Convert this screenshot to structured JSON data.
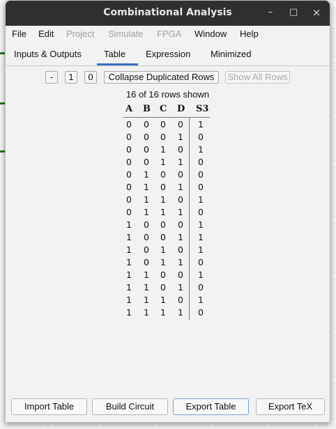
{
  "window": {
    "title": "Combinational Analysis",
    "controls": [
      "–",
      "□",
      "×"
    ]
  },
  "menu": [
    "File",
    "Edit",
    "Project",
    "Simulate",
    "FPGA",
    "Window",
    "Help"
  ],
  "menu_disabled": [
    false,
    false,
    true,
    true,
    true,
    false,
    false
  ],
  "tabs": [
    "Inputs & Outputs",
    "Table",
    "Expression",
    "Minimized"
  ],
  "active_tab": "Table",
  "toolbar": {
    "minus": "-",
    "one": "1",
    "zero": "0",
    "collapse": "Collapse Duplicated Rows",
    "show_all": "Show All Rows"
  },
  "rows_shown": "16 of 16 rows shown",
  "table": {
    "headers": [
      "A",
      "B",
      "C",
      "D",
      "S3"
    ],
    "rows": [
      [
        "0",
        "0",
        "0",
        "0",
        "1"
      ],
      [
        "0",
        "0",
        "0",
        "1",
        "0"
      ],
      [
        "0",
        "0",
        "1",
        "0",
        "1"
      ],
      [
        "0",
        "0",
        "1",
        "1",
        "0"
      ],
      [
        "0",
        "1",
        "0",
        "0",
        "0"
      ],
      [
        "0",
        "1",
        "0",
        "1",
        "0"
      ],
      [
        "0",
        "1",
        "1",
        "0",
        "1"
      ],
      [
        "0",
        "1",
        "1",
        "1",
        "0"
      ],
      [
        "1",
        "0",
        "0",
        "0",
        "1"
      ],
      [
        "1",
        "0",
        "0",
        "1",
        "1"
      ],
      [
        "1",
        "0",
        "1",
        "0",
        "1"
      ],
      [
        "1",
        "0",
        "1",
        "1",
        "0"
      ],
      [
        "1",
        "1",
        "0",
        "0",
        "1"
      ],
      [
        "1",
        "1",
        "0",
        "1",
        "0"
      ],
      [
        "1",
        "1",
        "1",
        "0",
        "1"
      ],
      [
        "1",
        "1",
        "1",
        "1",
        "0"
      ]
    ]
  },
  "footer": [
    "Import Table",
    "Build Circuit",
    "Export Table",
    "Export TeX"
  ]
}
